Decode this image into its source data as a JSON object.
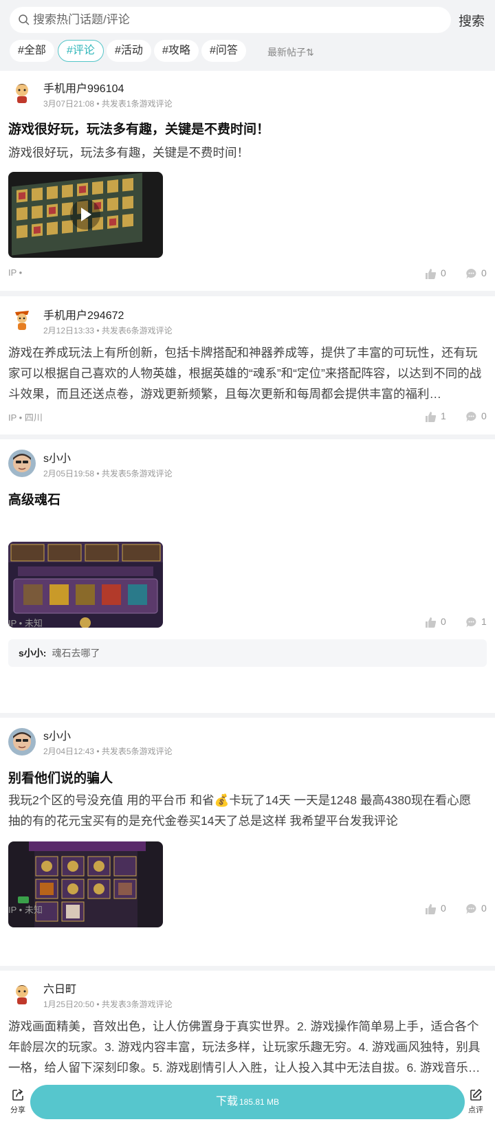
{
  "search": {
    "placeholder": "搜索热门话题/评论",
    "button_label": "搜索"
  },
  "filter_tags": [
    "#全部",
    "#评论",
    "#活动",
    "#攻略",
    "#问答"
  ],
  "active_tag": "#评论",
  "sort_label": "最新帖子⇅",
  "posts": [
    {
      "user": "手机用户996104",
      "meta": "3月07日21:08 • 共发表1条游戏评论",
      "title": "游戏很好玩，玩法多有趣，关键是不费时间！",
      "text": "游戏很好玩，玩法多有趣，关键是不费时间！",
      "ip": "IP •",
      "likes": "0",
      "comments": "0"
    },
    {
      "user": "手机用户294672",
      "meta": "2月12日13:33 • 共发表6条游戏评论",
      "text": "游戏在养成玩法上有所创新，包括卡牌搭配和神器养成等，提供了丰富的可玩性，还有玩家可以根据自己喜欢的人物英雄，根据英雄的“魂系”和“定位”来搭配阵容，以达到不同的战斗效果，而且还送点卷，游戏更新频繁，且每次更新和每周都会提供丰富的福利…",
      "ip": "IP • 四川",
      "likes": "1",
      "comments": "0"
    },
    {
      "user": "s小小",
      "meta": "2月05日19:58 • 共发表5条游戏评论",
      "title": "高级魂石",
      "ip": "IP • 未知",
      "likes": "0",
      "comments": "1",
      "reply_user": "s小小:",
      "reply_text": "魂石去哪了"
    },
    {
      "user": "s小小",
      "meta": "2月04日12:43 • 共发表5条游戏评论",
      "title": "别看他们说的骗人",
      "text": "我玩2个区的号没充值 用的平台币 和省💰卡玩了14天 一天是1248 最高4380现在看心愿抽的有的花元宝买有的是充代金卷买14天了总是这样 我希望平台发我评论",
      "ip": "IP • 未知",
      "likes": "0",
      "comments": "0"
    },
    {
      "user": "六日町",
      "meta": "1月25日20:50 • 共发表3条游戏评论",
      "text": "游戏画面精美，音效出色，让人仿佛置身于真实世界。2. 游戏操作简单易上手，适合各个年龄层次的玩家。3. 游戏内容丰富，玩法多样，让玩家乐趣无穷。4. 游戏画风独特，别具一格，给人留下深刻印象。5. 游戏剧情引人入胜，让人投入其中无法自拔。6. 游戏音乐…"
    }
  ],
  "bottom": {
    "share_label": "分享",
    "download_label": "下载",
    "download_size": "185.81 MB",
    "review_label": "点评"
  },
  "colors": {
    "accent": "#56c6cd",
    "page_bg": "#f2f3f5"
  }
}
